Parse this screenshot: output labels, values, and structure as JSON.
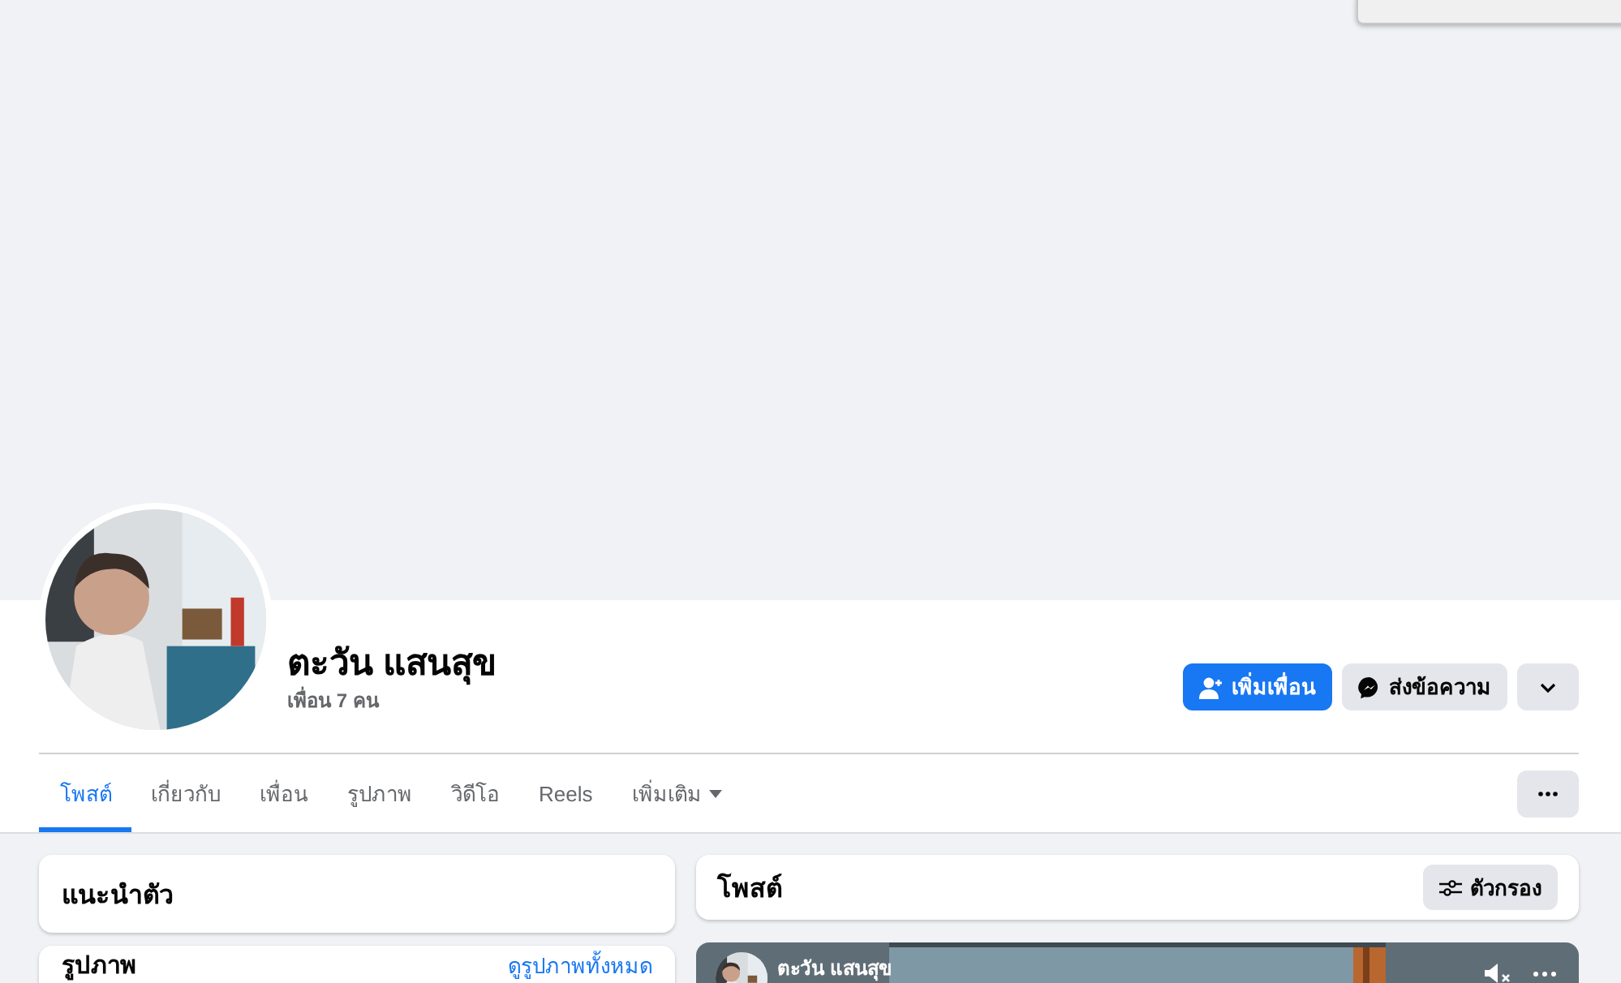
{
  "profile": {
    "name": "ตะวัน แสนสุข",
    "friends_count": "เพื่อน 7 คน"
  },
  "actions": [
    {
      "kind": "add_friend",
      "label": "เพิ่มเพื่อน"
    },
    {
      "kind": "message",
      "label": "ส่งข้อความ"
    },
    {
      "kind": "expand"
    }
  ],
  "tabs": [
    {
      "label": "โพสต์",
      "selected": true,
      "kind": "tab"
    },
    {
      "label": "เกี่ยวกับ",
      "selected": false,
      "kind": "tab"
    },
    {
      "label": "เพื่อน",
      "selected": false,
      "kind": "tab"
    },
    {
      "label": "รูปภาพ",
      "selected": false,
      "kind": "tab"
    },
    {
      "label": "วิดีโอ",
      "selected": false,
      "kind": "tab"
    },
    {
      "label": "Reels",
      "selected": false,
      "kind": "tab"
    },
    {
      "label": "เพิ่มเติม",
      "selected": false,
      "kind": "dropdown"
    }
  ],
  "intro_card": {
    "title": "แนะนำตัว"
  },
  "photos_card": {
    "title": "รูปภาพ",
    "link": "ดูรูปภาพทั้งหมด"
  },
  "posts_header": {
    "title": "โพสต์",
    "filter_button": "ตัวกรอง"
  },
  "post": {
    "author": "ตะวัน แสนสุข",
    "kind": "video"
  }
}
